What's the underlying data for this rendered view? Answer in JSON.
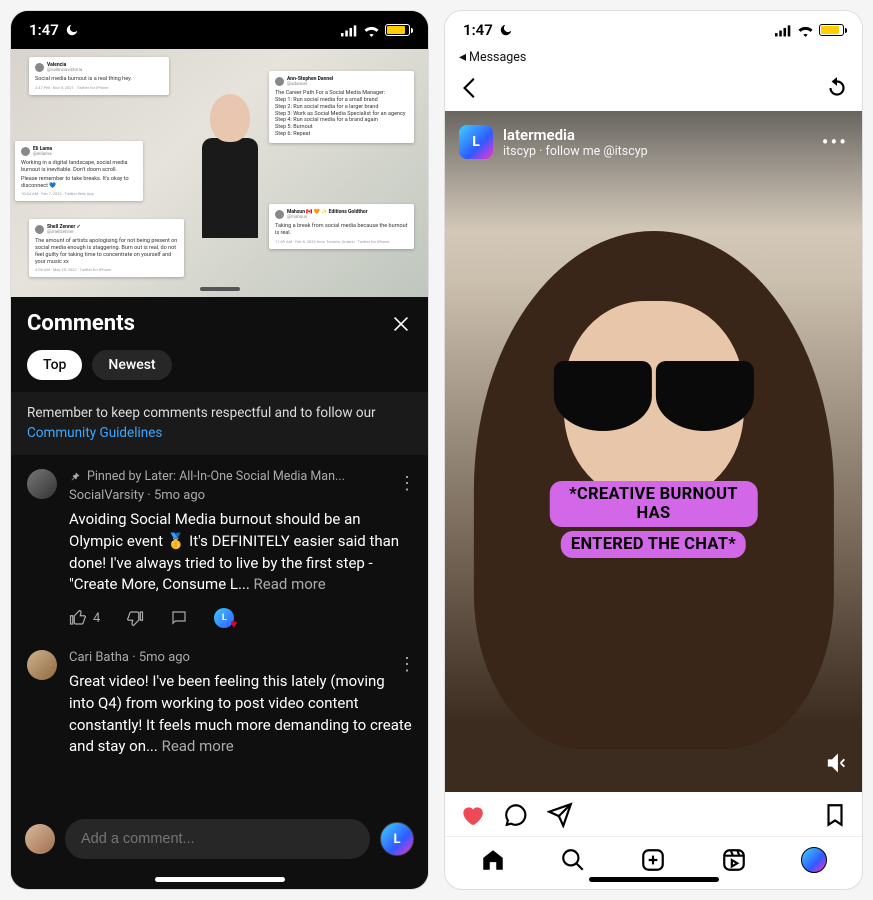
{
  "status": {
    "time": "1:47",
    "battery_color": "#ffce00"
  },
  "youtube": {
    "video_tweets": {
      "t1": {
        "name": "Valencia",
        "handle": "@valenciavictoria",
        "text": "Social media burnout is a real thing hey.",
        "meta": "2:47 PM · Nov 5, 2021 · Twitter for iPhone"
      },
      "t2": {
        "name": "Ann-Stephen Dannel",
        "handle": "@adannel",
        "title": "The Career Path For a Social Media Manager:",
        "s1": "Step 1: Run social media for a small brand",
        "s2": "Step 2: Run social media for a larger brand",
        "s3": "Step 3: Work as Social Media Specialist for an agency",
        "s4": "Step 4: Run social media for a brand again",
        "s5": "Step 5: Burnout",
        "s6": "Step 6: Repeat"
      },
      "t3": {
        "name": "Eli Lama",
        "handle": "@elilama",
        "line1": "Working in a digital landscape, social media burnout is inevitable. Don't doom scroll.",
        "line2": "Please remember to take breaks. It's okay to disconnect 💙",
        "meta": "10:04 AM · Feb 7, 2022 · Twitter Web App"
      },
      "t4": {
        "name": "Mahsun 🇨🇦 🧡 ✨ Editions Goldthor",
        "handle": "@mahsun",
        "text": "Taking a break from social media because the burnout is real.",
        "meta": "11:09 AM · Feb 8, 2023 from Toronto, Ontario · Twitter for iPhone"
      },
      "t5": {
        "name": "Shell Zenner ✓",
        "handle": "@shellzenner",
        "text": "The amount of artists apologising for not being present on social media enough is staggering. Burn out is real, do not feel guilty for taking time to concentrate on yourself and your music xx",
        "meta": "4:08 AM · May 25, 2022 · Twitter for iPhone"
      }
    },
    "comments_title": "Comments",
    "tabs": {
      "top": "Top",
      "newest": "Newest"
    },
    "notice_prefix": "Remember to keep comments respectful and to follow our ",
    "notice_link": "Community Guidelines",
    "pinned_label": "Pinned by Later: All-In-One Social Media Man...",
    "comment1": {
      "author": "SocialVarsity",
      "age": "5mo ago",
      "text": "Avoiding Social Media burnout should be an Olympic event 🥇 It's DEFINITELY easier said than done! I've always tried to live by the first step - \"Create More, Consume L... ",
      "readmore": "Read more",
      "likes": "4"
    },
    "comment2": {
      "author": "Cari Batha",
      "age": "5mo ago",
      "text": "Great video! I've been feeling this lately (moving into Q4) from working to post video content constantly! It feels much more demanding to create and stay on... ",
      "readmore": "Read more"
    },
    "composer_placeholder": "Add a comment..."
  },
  "instagram": {
    "back_label": "Messages",
    "username": "latermedia",
    "subline": "itscyp · follow me @itscyp",
    "caption_line1": "*CREATIVE BURNOUT HAS",
    "caption_line2": "ENTERED THE CHAT*"
  },
  "icons": {
    "moon": "moon-icon",
    "signal": "signal-icon",
    "wifi": "wifi-icon",
    "close": "close-icon",
    "pin": "pin-icon",
    "thumbs_up": "thumbs-up-icon",
    "thumbs_down": "thumbs-down-icon",
    "reply": "comment-icon",
    "back": "chevron-left-icon",
    "replay": "replay-icon",
    "heart": "heart-icon",
    "chat": "chat-bubble-icon",
    "send": "send-icon",
    "bookmark": "bookmark-icon",
    "mute": "mute-icon",
    "home": "home-icon",
    "search": "search-icon",
    "add": "add-post-icon",
    "reels": "reels-icon"
  }
}
